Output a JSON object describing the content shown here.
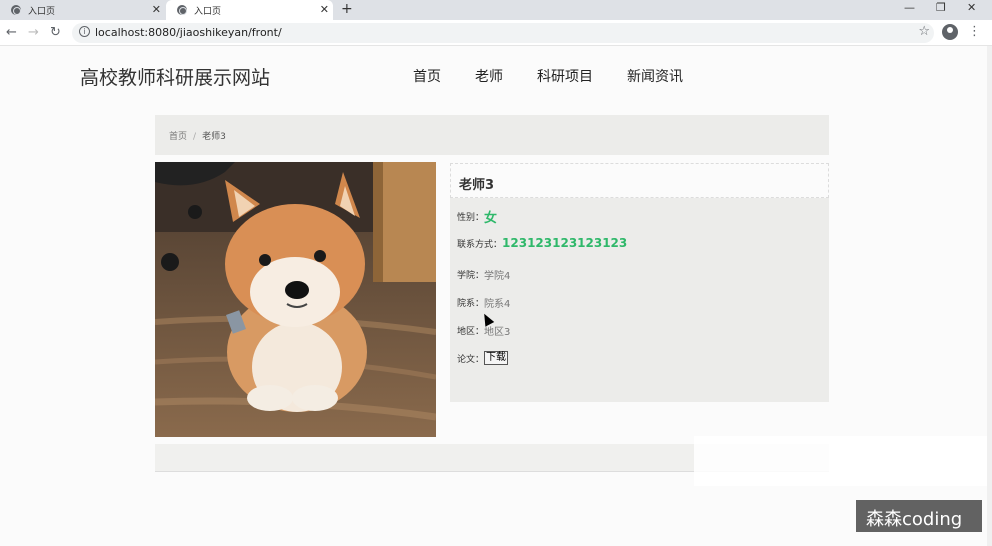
{
  "browser": {
    "tabs": [
      {
        "label": "入口页"
      },
      {
        "label": "入口页"
      }
    ],
    "url": "localhost:8080/jiaoshikeyan/front/"
  },
  "site": {
    "title": "高校教师科研展示网站",
    "nav": [
      "首页",
      "老师",
      "科研项目",
      "新闻资讯"
    ]
  },
  "breadcrumb": {
    "home": "首页",
    "separator": "/",
    "current": "老师3"
  },
  "teacher": {
    "name": "老师3",
    "gender_label": "性别：",
    "gender": "女",
    "contact_label": "联系方式：",
    "contact": "123123123123123",
    "college_label": "学院：",
    "college": "学院4",
    "dept_label": "院系：",
    "dept": "院系4",
    "region_label": "地区：",
    "region": "地区3",
    "paper_label": "论文：",
    "download": "下载"
  },
  "watermark": "森森coding",
  "colors": {
    "accent_green": "#2fb86a"
  }
}
